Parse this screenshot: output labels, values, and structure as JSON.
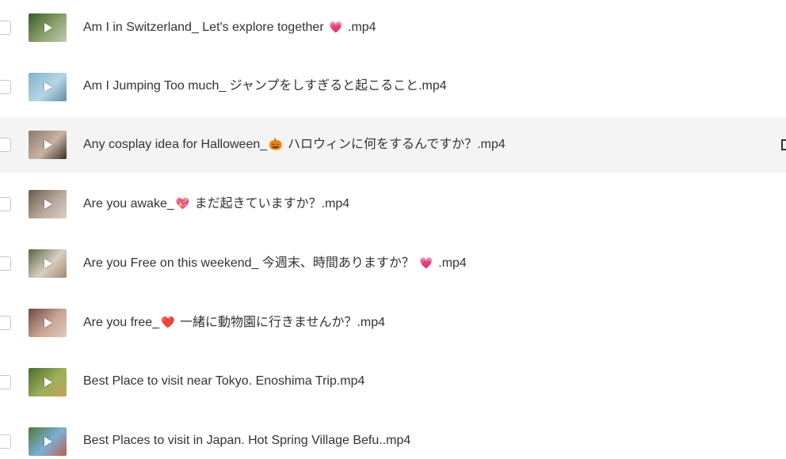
{
  "files": [
    {
      "name_prefix": "Am I in Switzerland_ Let's explore together ",
      "emoji": "💗",
      "name_suffix": " .mp4",
      "thumb_colors": [
        "#3f5a2c",
        "#8aa36a",
        "#c2c7b8"
      ]
    },
    {
      "name_prefix": "Am I Jumping Too much_ ジャンプをしすぎると起こること.mp4",
      "emoji": "",
      "name_suffix": "",
      "thumb_colors": [
        "#7fb2c9",
        "#b7d6e4",
        "#5f8ea3"
      ]
    },
    {
      "name_prefix": "Any cosplay idea for Halloween_",
      "emoji": "🎃",
      "name_suffix": " ハロウィンに何をするんですか？.mp4",
      "thumb_colors": [
        "#8b7a6e",
        "#c9b3a2",
        "#3b302a"
      ],
      "highlight": true
    },
    {
      "name_prefix": "Are you awake_",
      "emoji": "💖",
      "name_suffix": " まだ起きていますか？.mp4",
      "thumb_colors": [
        "#6b5a4a",
        "#b8a89a",
        "#d9cfc6"
      ]
    },
    {
      "name_prefix": "Are you Free on this weekend_ 今週末、時間ありますか？ ",
      "emoji": "💗",
      "name_suffix": " .mp4",
      "thumb_colors": [
        "#56663f",
        "#d8cfc3",
        "#a3886f"
      ]
    },
    {
      "name_prefix": "Are you free_",
      "emoji": "❤️",
      "name_suffix": " 一緒に動物園に行きませんか？.mp4",
      "thumb_colors": [
        "#6b4a3e",
        "#c9a596",
        "#e2c9be"
      ]
    },
    {
      "name_prefix": "Best Place to visit near Tokyo. Enoshima Trip.mp4",
      "emoji": "",
      "name_suffix": "",
      "thumb_colors": [
        "#4d6a2b",
        "#9bb05a",
        "#c9a05a"
      ]
    },
    {
      "name_prefix": "Best Places to visit in Japan. Hot Spring Village Befu..mp4",
      "emoji": "",
      "name_suffix": "",
      "thumb_colors": [
        "#4f7a3c",
        "#7bb0d6",
        "#c45b4a"
      ]
    }
  ]
}
